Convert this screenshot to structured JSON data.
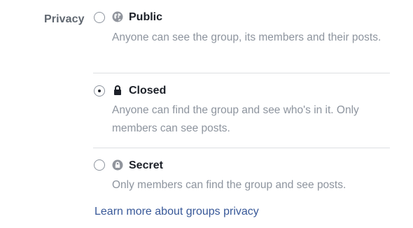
{
  "privacy": {
    "label": "Privacy",
    "options": [
      {
        "title": "Public",
        "icon": "globe-icon",
        "description": "Anyone can see the group, its members and their posts.",
        "selected": false
      },
      {
        "title": "Closed",
        "icon": "lock-icon",
        "description": "Anyone can find the group and see who's in it. Only members can see posts.",
        "selected": true
      },
      {
        "title": "Secret",
        "icon": "secret-lock-icon",
        "description": "Only members can find the group and see posts.",
        "selected": false
      }
    ],
    "learn_more": "Learn more about groups privacy"
  },
  "colors": {
    "label": "#606770",
    "title": "#1d2129",
    "description": "#8d949e",
    "link": "#385898",
    "divider": "#dddfe2"
  }
}
